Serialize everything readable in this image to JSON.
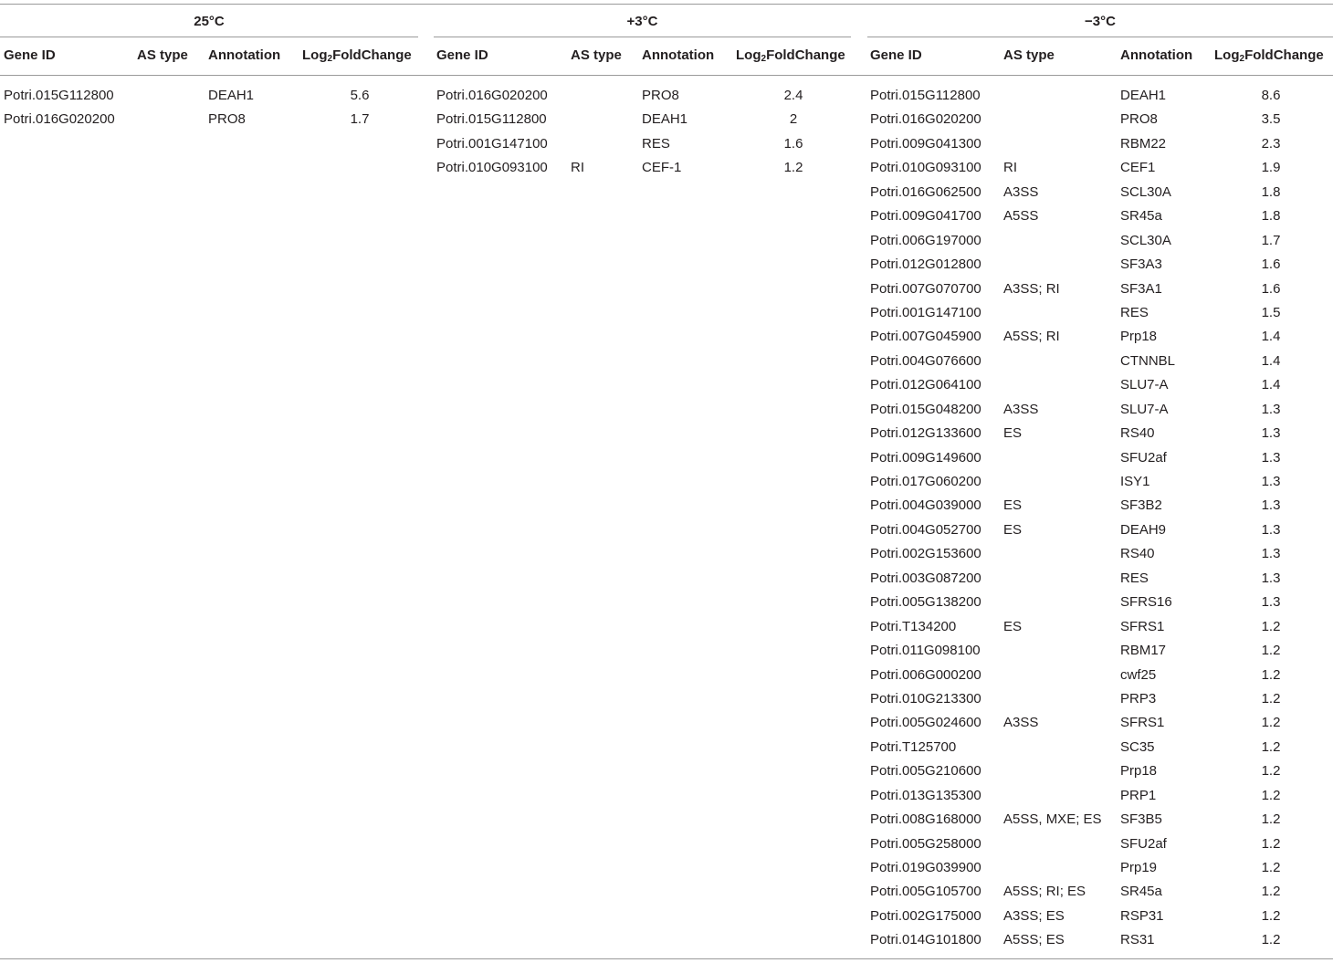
{
  "groups": [
    {
      "title": "25°C",
      "headers": {
        "gene_id": "Gene ID",
        "as_type": "AS type",
        "annotation": "Annotation",
        "lfc_prefix": "Log",
        "lfc_sub": "2",
        "lfc_suffix": "FoldChange"
      },
      "rows": [
        {
          "gene_id": "Potri.015G112800",
          "as_type": "",
          "annotation": "DEAH1",
          "lfc": "5.6"
        },
        {
          "gene_id": "Potri.016G020200",
          "as_type": "",
          "annotation": "PRO8",
          "lfc": "1.7"
        }
      ]
    },
    {
      "title": "+3°C",
      "headers": {
        "gene_id": "Gene ID",
        "as_type": "AS type",
        "annotation": "Annotation",
        "lfc_prefix": "Log",
        "lfc_sub": "2",
        "lfc_suffix": "FoldChange"
      },
      "rows": [
        {
          "gene_id": "Potri.016G020200",
          "as_type": "",
          "annotation": "PRO8",
          "lfc": "2.4"
        },
        {
          "gene_id": "Potri.015G112800",
          "as_type": "",
          "annotation": "DEAH1",
          "lfc": "2"
        },
        {
          "gene_id": "Potri.001G147100",
          "as_type": "",
          "annotation": "RES",
          "lfc": "1.6"
        },
        {
          "gene_id": "Potri.010G093100",
          "as_type": "RI",
          "annotation": "CEF-1",
          "lfc": "1.2"
        }
      ]
    },
    {
      "title": "−3°C",
      "headers": {
        "gene_id": "Gene ID",
        "as_type": "AS type",
        "annotation": "Annotation",
        "lfc_prefix": "Log",
        "lfc_sub": "2",
        "lfc_suffix": "FoldChange"
      },
      "rows": [
        {
          "gene_id": "Potri.015G112800",
          "as_type": "",
          "annotation": "DEAH1",
          "lfc": "8.6"
        },
        {
          "gene_id": "Potri.016G020200",
          "as_type": "",
          "annotation": "PRO8",
          "lfc": "3.5"
        },
        {
          "gene_id": "Potri.009G041300",
          "as_type": "",
          "annotation": "RBM22",
          "lfc": "2.3"
        },
        {
          "gene_id": "Potri.010G093100",
          "as_type": "RI",
          "annotation": "CEF1",
          "lfc": "1.9"
        },
        {
          "gene_id": "Potri.016G062500",
          "as_type": "A3SS",
          "annotation": "SCL30A",
          "lfc": "1.8"
        },
        {
          "gene_id": "Potri.009G041700",
          "as_type": "A5SS",
          "annotation": "SR45a",
          "lfc": "1.8"
        },
        {
          "gene_id": "Potri.006G197000",
          "as_type": "",
          "annotation": "SCL30A",
          "lfc": "1.7"
        },
        {
          "gene_id": "Potri.012G012800",
          "as_type": "",
          "annotation": "SF3A3",
          "lfc": "1.6"
        },
        {
          "gene_id": "Potri.007G070700",
          "as_type": "A3SS; RI",
          "annotation": "SF3A1",
          "lfc": "1.6"
        },
        {
          "gene_id": "Potri.001G147100",
          "as_type": "",
          "annotation": "RES",
          "lfc": "1.5"
        },
        {
          "gene_id": "Potri.007G045900",
          "as_type": "A5SS; RI",
          "annotation": "Prp18",
          "lfc": "1.4"
        },
        {
          "gene_id": "Potri.004G076600",
          "as_type": "",
          "annotation": "CTNNBL",
          "lfc": "1.4"
        },
        {
          "gene_id": "Potri.012G064100",
          "as_type": "",
          "annotation": "SLU7-A",
          "lfc": "1.4"
        },
        {
          "gene_id": "Potri.015G048200",
          "as_type": "A3SS",
          "annotation": "SLU7-A",
          "lfc": "1.3"
        },
        {
          "gene_id": "Potri.012G133600",
          "as_type": "ES",
          "annotation": "RS40",
          "lfc": "1.3"
        },
        {
          "gene_id": "Potri.009G149600",
          "as_type": "",
          "annotation": "SFU2af",
          "lfc": "1.3"
        },
        {
          "gene_id": "Potri.017G060200",
          "as_type": "",
          "annotation": "ISY1",
          "lfc": "1.3"
        },
        {
          "gene_id": "Potri.004G039000",
          "as_type": "ES",
          "annotation": "SF3B2",
          "lfc": "1.3"
        },
        {
          "gene_id": "Potri.004G052700",
          "as_type": "ES",
          "annotation": "DEAH9",
          "lfc": "1.3"
        },
        {
          "gene_id": "Potri.002G153600",
          "as_type": "",
          "annotation": "RS40",
          "lfc": "1.3"
        },
        {
          "gene_id": "Potri.003G087200",
          "as_type": "",
          "annotation": "RES",
          "lfc": "1.3"
        },
        {
          "gene_id": "Potri.005G138200",
          "as_type": "",
          "annotation": "SFRS16",
          "lfc": "1.3"
        },
        {
          "gene_id": "Potri.T134200",
          "as_type": "ES",
          "annotation": "SFRS1",
          "lfc": "1.2"
        },
        {
          "gene_id": "Potri.011G098100",
          "as_type": "",
          "annotation": "RBM17",
          "lfc": "1.2"
        },
        {
          "gene_id": "Potri.006G000200",
          "as_type": "",
          "annotation": "cwf25",
          "lfc": "1.2"
        },
        {
          "gene_id": "Potri.010G213300",
          "as_type": "",
          "annotation": "PRP3",
          "lfc": "1.2"
        },
        {
          "gene_id": "Potri.005G024600",
          "as_type": "A3SS",
          "annotation": "SFRS1",
          "lfc": "1.2"
        },
        {
          "gene_id": "Potri.T125700",
          "as_type": "",
          "annotation": "SC35",
          "lfc": "1.2"
        },
        {
          "gene_id": "Potri.005G210600",
          "as_type": "",
          "annotation": "Prp18",
          "lfc": "1.2"
        },
        {
          "gene_id": "Potri.013G135300",
          "as_type": "",
          "annotation": "PRP1",
          "lfc": "1.2"
        },
        {
          "gene_id": "Potri.008G168000",
          "as_type": "A5SS, MXE; ES",
          "annotation": "SF3B5",
          "lfc": "1.2"
        },
        {
          "gene_id": "Potri.005G258000",
          "as_type": "",
          "annotation": "SFU2af",
          "lfc": "1.2"
        },
        {
          "gene_id": "Potri.019G039900",
          "as_type": "",
          "annotation": "Prp19",
          "lfc": "1.2"
        },
        {
          "gene_id": "Potri.005G105700",
          "as_type": "A5SS; RI; ES",
          "annotation": "SR45a",
          "lfc": "1.2"
        },
        {
          "gene_id": "Potri.002G175000",
          "as_type": "A3SS; ES",
          "annotation": "RSP31",
          "lfc": "1.2"
        },
        {
          "gene_id": "Potri.014G101800",
          "as_type": "A5SS; ES",
          "annotation": "RS31",
          "lfc": "1.2"
        }
      ]
    }
  ]
}
